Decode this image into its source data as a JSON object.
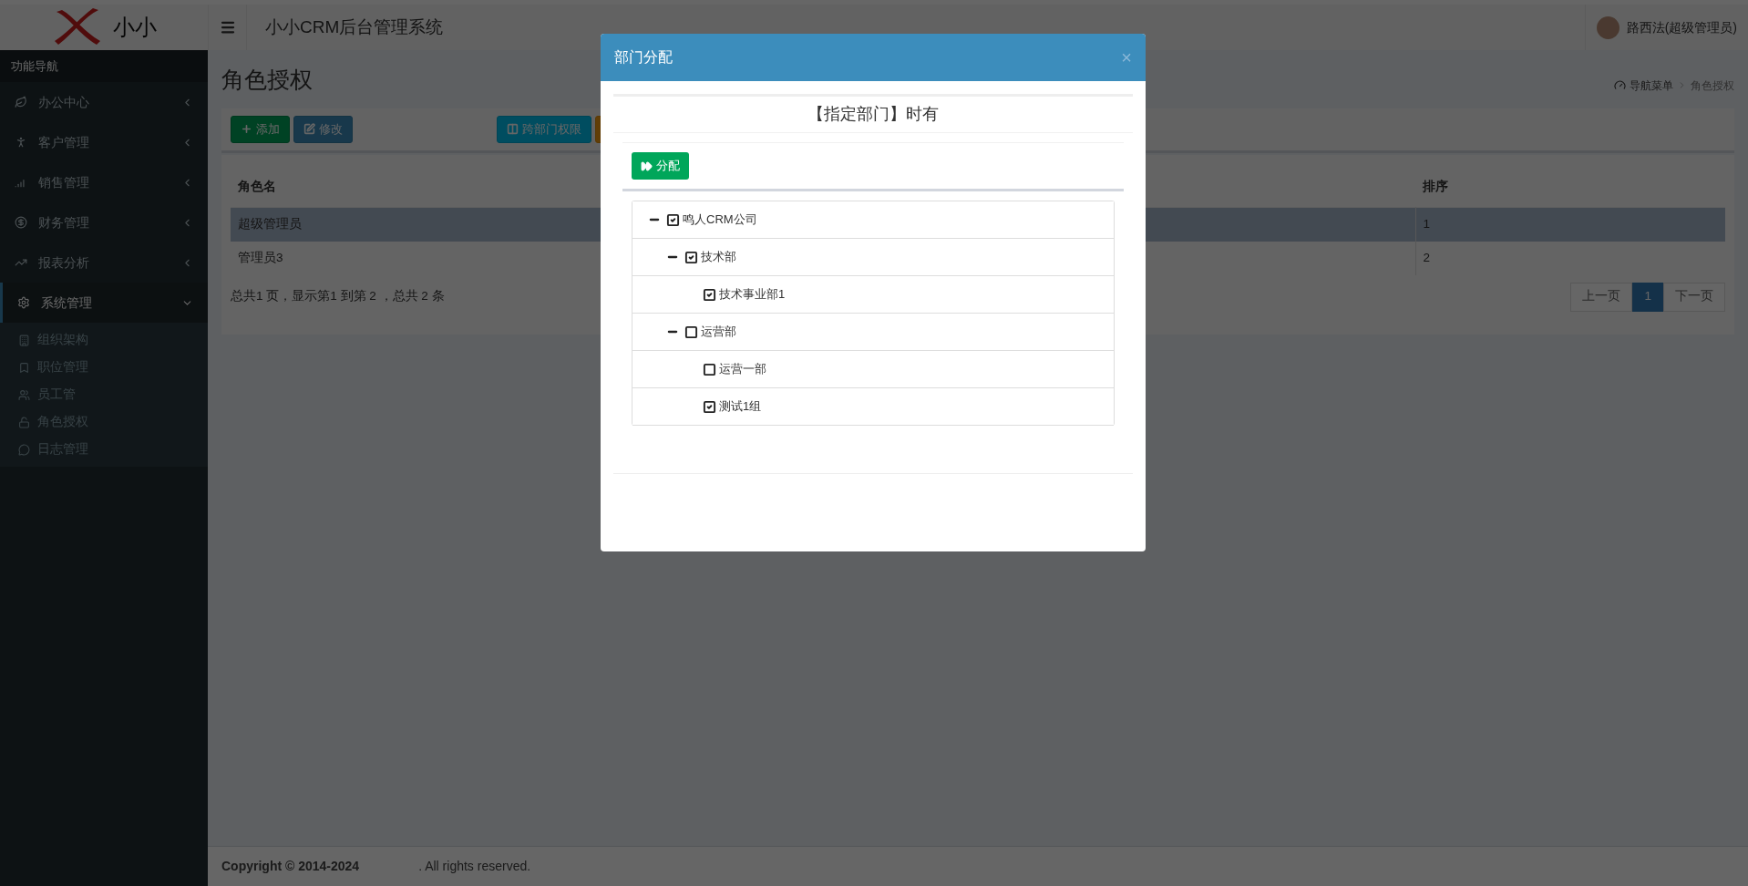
{
  "header": {
    "logo_text": "小小",
    "title": "小小CRM后台管理系统",
    "user": "路西法(超级管理员)"
  },
  "sidebar": {
    "heading": "功能导航",
    "items": [
      {
        "label": "办公中心",
        "expanded": false
      },
      {
        "label": "客户管理",
        "expanded": false
      },
      {
        "label": "销售管理",
        "expanded": false
      },
      {
        "label": "财务管理",
        "expanded": false
      },
      {
        "label": "报表分析",
        "expanded": false
      },
      {
        "label": "系统管理",
        "expanded": true,
        "children": [
          {
            "label": "组织架构"
          },
          {
            "label": "职位管理"
          },
          {
            "label": "员工管"
          },
          {
            "label": "角色授权"
          },
          {
            "label": "日志管理"
          }
        ]
      }
    ]
  },
  "page": {
    "title": "角色授权",
    "breadcrumb": [
      "导航菜单",
      "角色授权"
    ]
  },
  "toolbar": [
    {
      "kind": "success",
      "label": "添加"
    },
    {
      "kind": "primary",
      "label": "修改"
    },
    {
      "kind": "spacer"
    },
    {
      "kind": "info",
      "label": "跨部门权限"
    },
    {
      "kind": "warning"
    }
  ],
  "table": {
    "columns": [
      "角色名",
      "排序"
    ],
    "rows": [
      {
        "cells": [
          "超级管理员",
          "1"
        ],
        "selected": true
      },
      {
        "cells": [
          "管理员3",
          "2"
        ],
        "selected": false
      }
    ],
    "summary": "总共1 页，显示第1 到第 2 ，总共 2 条"
  },
  "pagination": [
    {
      "label": "上一页",
      "selected": false
    },
    {
      "label": "1",
      "selected": true
    },
    {
      "label": "下一页",
      "selected": false
    }
  ],
  "footer": {
    "copyright": "Copyright © 2014-2024",
    "rights": ". All rights reserved."
  },
  "modal": {
    "title": "部门分配",
    "close": "×",
    "heading": "【指定部门】时有",
    "button": "分配",
    "tree": [
      {
        "label": "鸣人CRM公司",
        "checked": true,
        "expanded": true,
        "children": [
          {
            "label": "技术部",
            "checked": true,
            "expanded": true,
            "children": [
              {
                "label": "技术事业部1",
                "checked": true
              }
            ]
          },
          {
            "label": "运营部",
            "checked": false,
            "expanded": true,
            "children": [
              {
                "label": "运营一部",
                "checked": false
              },
              {
                "label": "测试1组",
                "checked": true
              }
            ]
          }
        ]
      }
    ]
  }
}
